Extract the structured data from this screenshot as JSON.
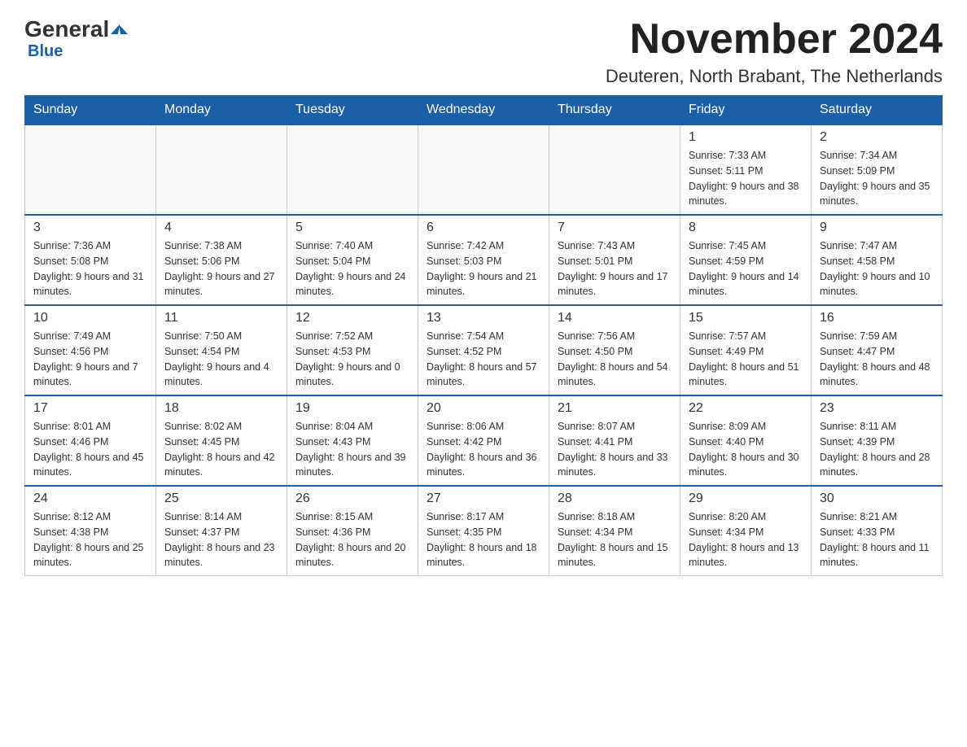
{
  "logo": {
    "general": "General",
    "arrow": "▶",
    "blue": "Blue"
  },
  "header": {
    "month_year": "November 2024",
    "location": "Deuteren, North Brabant, The Netherlands"
  },
  "weekdays": [
    "Sunday",
    "Monday",
    "Tuesday",
    "Wednesday",
    "Thursday",
    "Friday",
    "Saturday"
  ],
  "weeks": [
    [
      {
        "day": "",
        "info": ""
      },
      {
        "day": "",
        "info": ""
      },
      {
        "day": "",
        "info": ""
      },
      {
        "day": "",
        "info": ""
      },
      {
        "day": "",
        "info": ""
      },
      {
        "day": "1",
        "info": "Sunrise: 7:33 AM\nSunset: 5:11 PM\nDaylight: 9 hours and 38 minutes."
      },
      {
        "day": "2",
        "info": "Sunrise: 7:34 AM\nSunset: 5:09 PM\nDaylight: 9 hours and 35 minutes."
      }
    ],
    [
      {
        "day": "3",
        "info": "Sunrise: 7:36 AM\nSunset: 5:08 PM\nDaylight: 9 hours and 31 minutes."
      },
      {
        "day": "4",
        "info": "Sunrise: 7:38 AM\nSunset: 5:06 PM\nDaylight: 9 hours and 27 minutes."
      },
      {
        "day": "5",
        "info": "Sunrise: 7:40 AM\nSunset: 5:04 PM\nDaylight: 9 hours and 24 minutes."
      },
      {
        "day": "6",
        "info": "Sunrise: 7:42 AM\nSunset: 5:03 PM\nDaylight: 9 hours and 21 minutes."
      },
      {
        "day": "7",
        "info": "Sunrise: 7:43 AM\nSunset: 5:01 PM\nDaylight: 9 hours and 17 minutes."
      },
      {
        "day": "8",
        "info": "Sunrise: 7:45 AM\nSunset: 4:59 PM\nDaylight: 9 hours and 14 minutes."
      },
      {
        "day": "9",
        "info": "Sunrise: 7:47 AM\nSunset: 4:58 PM\nDaylight: 9 hours and 10 minutes."
      }
    ],
    [
      {
        "day": "10",
        "info": "Sunrise: 7:49 AM\nSunset: 4:56 PM\nDaylight: 9 hours and 7 minutes."
      },
      {
        "day": "11",
        "info": "Sunrise: 7:50 AM\nSunset: 4:54 PM\nDaylight: 9 hours and 4 minutes."
      },
      {
        "day": "12",
        "info": "Sunrise: 7:52 AM\nSunset: 4:53 PM\nDaylight: 9 hours and 0 minutes."
      },
      {
        "day": "13",
        "info": "Sunrise: 7:54 AM\nSunset: 4:52 PM\nDaylight: 8 hours and 57 minutes."
      },
      {
        "day": "14",
        "info": "Sunrise: 7:56 AM\nSunset: 4:50 PM\nDaylight: 8 hours and 54 minutes."
      },
      {
        "day": "15",
        "info": "Sunrise: 7:57 AM\nSunset: 4:49 PM\nDaylight: 8 hours and 51 minutes."
      },
      {
        "day": "16",
        "info": "Sunrise: 7:59 AM\nSunset: 4:47 PM\nDaylight: 8 hours and 48 minutes."
      }
    ],
    [
      {
        "day": "17",
        "info": "Sunrise: 8:01 AM\nSunset: 4:46 PM\nDaylight: 8 hours and 45 minutes."
      },
      {
        "day": "18",
        "info": "Sunrise: 8:02 AM\nSunset: 4:45 PM\nDaylight: 8 hours and 42 minutes."
      },
      {
        "day": "19",
        "info": "Sunrise: 8:04 AM\nSunset: 4:43 PM\nDaylight: 8 hours and 39 minutes."
      },
      {
        "day": "20",
        "info": "Sunrise: 8:06 AM\nSunset: 4:42 PM\nDaylight: 8 hours and 36 minutes."
      },
      {
        "day": "21",
        "info": "Sunrise: 8:07 AM\nSunset: 4:41 PM\nDaylight: 8 hours and 33 minutes."
      },
      {
        "day": "22",
        "info": "Sunrise: 8:09 AM\nSunset: 4:40 PM\nDaylight: 8 hours and 30 minutes."
      },
      {
        "day": "23",
        "info": "Sunrise: 8:11 AM\nSunset: 4:39 PM\nDaylight: 8 hours and 28 minutes."
      }
    ],
    [
      {
        "day": "24",
        "info": "Sunrise: 8:12 AM\nSunset: 4:38 PM\nDaylight: 8 hours and 25 minutes."
      },
      {
        "day": "25",
        "info": "Sunrise: 8:14 AM\nSunset: 4:37 PM\nDaylight: 8 hours and 23 minutes."
      },
      {
        "day": "26",
        "info": "Sunrise: 8:15 AM\nSunset: 4:36 PM\nDaylight: 8 hours and 20 minutes."
      },
      {
        "day": "27",
        "info": "Sunrise: 8:17 AM\nSunset: 4:35 PM\nDaylight: 8 hours and 18 minutes."
      },
      {
        "day": "28",
        "info": "Sunrise: 8:18 AM\nSunset: 4:34 PM\nDaylight: 8 hours and 15 minutes."
      },
      {
        "day": "29",
        "info": "Sunrise: 8:20 AM\nSunset: 4:34 PM\nDaylight: 8 hours and 13 minutes."
      },
      {
        "day": "30",
        "info": "Sunrise: 8:21 AM\nSunset: 4:33 PM\nDaylight: 8 hours and 11 minutes."
      }
    ]
  ]
}
